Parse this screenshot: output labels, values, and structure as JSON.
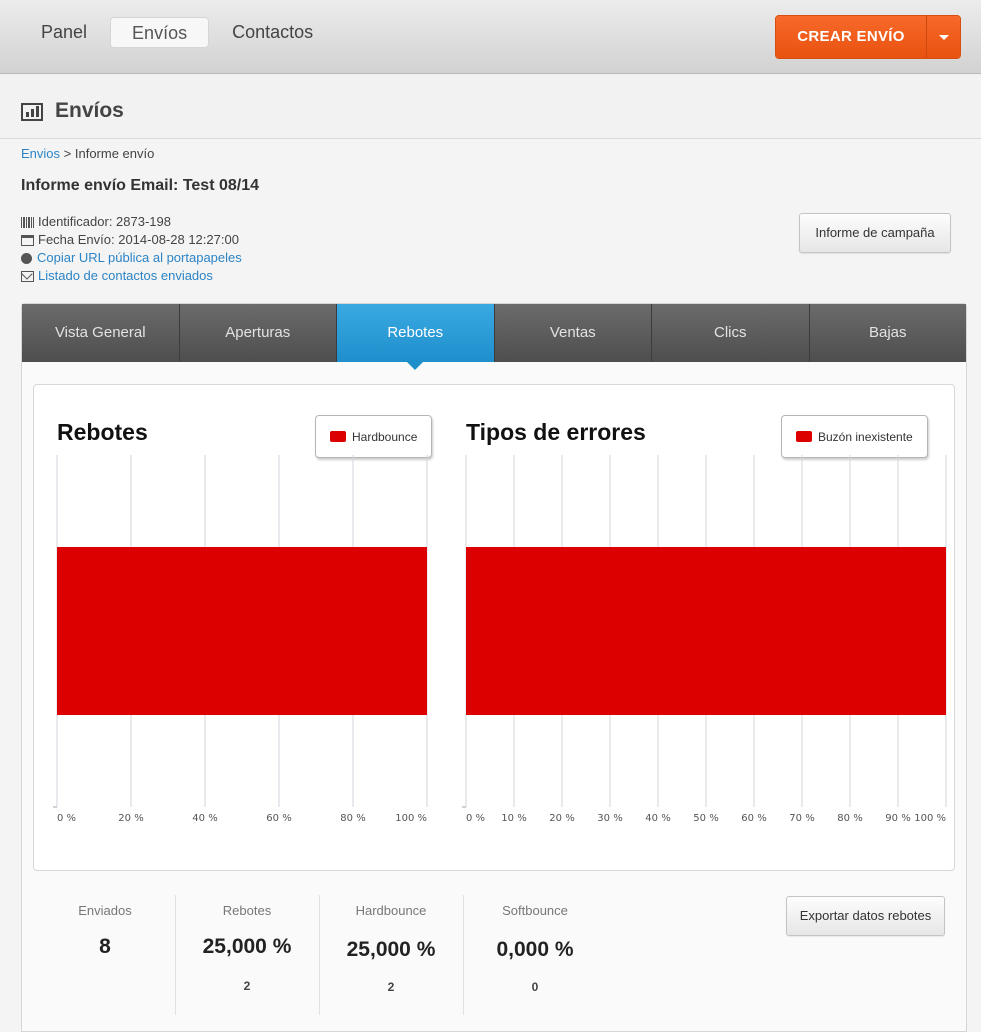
{
  "topbar": {
    "nav": [
      {
        "label": "Panel"
      },
      {
        "label": "Envíos"
      },
      {
        "label": "Contactos"
      }
    ],
    "create_label": "CREAR ENVÍO",
    "accent": "#ef5d1b"
  },
  "header": {
    "title": "Envíos",
    "breadcrumb_link": "Envios",
    "breadcrumb_sep": ">",
    "breadcrumb_current": "Informe envío"
  },
  "report": {
    "title": "Informe envío Email: Test 08/14",
    "id_label": "Identificador: 2873-198",
    "date_label": "Fecha Envío: 2014-08-28 12:27:00",
    "copy_url_label": "Copiar URL pública al portapapeles",
    "contacts_link_label": "Listado de contactos enviados",
    "campaign_button": "Informe de campaña"
  },
  "tabs": [
    {
      "label": "Vista General"
    },
    {
      "label": "Aperturas"
    },
    {
      "label": "Rebotes"
    },
    {
      "label": "Ventas"
    },
    {
      "label": "Clics"
    },
    {
      "label": "Bajas"
    }
  ],
  "active_tab_color": "#2a9bd8",
  "chart_data": [
    {
      "type": "bar",
      "orientation": "horizontal",
      "title": "Rebotes",
      "categories": [
        ""
      ],
      "series": [
        {
          "name": "Hardbounce",
          "values": [
            100
          ],
          "color": "#dd0000"
        }
      ],
      "xlim": [
        0,
        100
      ],
      "xticks": [
        "0 %",
        "20 %",
        "40 %",
        "60 %",
        "80 %",
        "100 %"
      ],
      "tick_values": [
        0,
        20,
        40,
        60,
        80,
        100
      ],
      "grid": true,
      "legend": "top-right"
    },
    {
      "type": "bar",
      "orientation": "horizontal",
      "title": "Tipos de errores",
      "categories": [
        ""
      ],
      "series": [
        {
          "name": "Buzón inexistente",
          "values": [
            100
          ],
          "color": "#dd0000"
        }
      ],
      "xlim": [
        0,
        100
      ],
      "xticks": [
        "0 %",
        "10 %",
        "20 %",
        "30 %",
        "40 %",
        "50 %",
        "60 %",
        "70 %",
        "80 %",
        "90 %",
        "100 %"
      ],
      "tick_values": [
        0,
        10,
        20,
        30,
        40,
        50,
        60,
        70,
        80,
        90,
        100
      ],
      "grid": true,
      "legend": "top-right"
    }
  ],
  "stats": [
    {
      "label": "Enviados",
      "value": "8",
      "sub": ""
    },
    {
      "label": "Rebotes",
      "value": "25,000 %",
      "sub": "2"
    },
    {
      "label": "Hardbounce",
      "value": "25,000 %",
      "sub": "2"
    },
    {
      "label": "Softbounce",
      "value": "0,000 %",
      "sub": "0"
    }
  ],
  "export_button": "Exportar datos rebotes"
}
